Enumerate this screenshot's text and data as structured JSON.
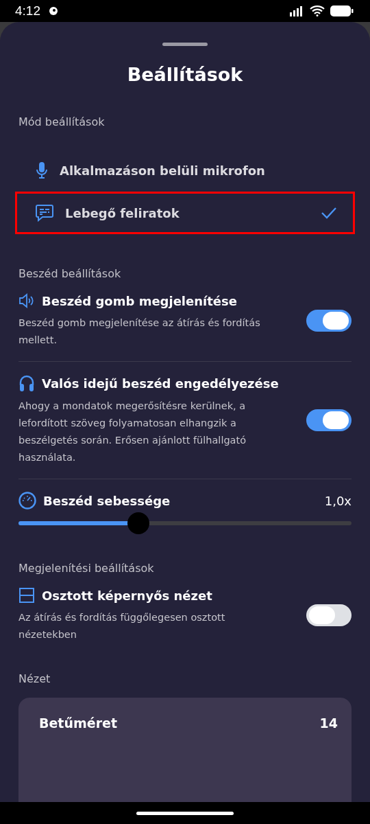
{
  "status_bar": {
    "time": "4:12"
  },
  "title": "Beállítások",
  "mode_section": {
    "heading": "Mód beállítások",
    "options": [
      {
        "kind": "mic",
        "label": "Alkalmazáson belüli mikrofon",
        "selected": false
      },
      {
        "kind": "captions",
        "label": "Lebegő feliratok",
        "selected": true
      }
    ]
  },
  "speech_section": {
    "heading": "Beszéd beállítások",
    "settings": [
      {
        "kind": "toggle",
        "title": "Beszéd gomb megjelenítése",
        "description": "Beszéd gomb megjelenítése az átírás és fordítás mellett.",
        "on": true
      },
      {
        "kind": "toggle",
        "title": "Valós idejű beszéd engedélyezése",
        "description": "Ahogy a mondatok megerősítésre kerülnek, a lefordított szöveg folyamatosan elhangzik a beszélgetés során. Erősen ajánlott fülhallgató használata.",
        "on": true
      },
      {
        "kind": "slider",
        "title": "Beszéd sebessége",
        "reading": "1,0x",
        "level": 0.36
      }
    ]
  },
  "display_section": {
    "heading": "Megjelenítési beállítások",
    "settings": [
      {
        "kind": "toggle",
        "title": "Osztott képernyős nézet",
        "description": "Az átírás és fordítás függőlegesen osztott nézetekben",
        "on": false
      }
    ]
  },
  "view_section": {
    "heading": "Nézet",
    "card": {
      "label": "Betűméret",
      "value": "14"
    }
  }
}
